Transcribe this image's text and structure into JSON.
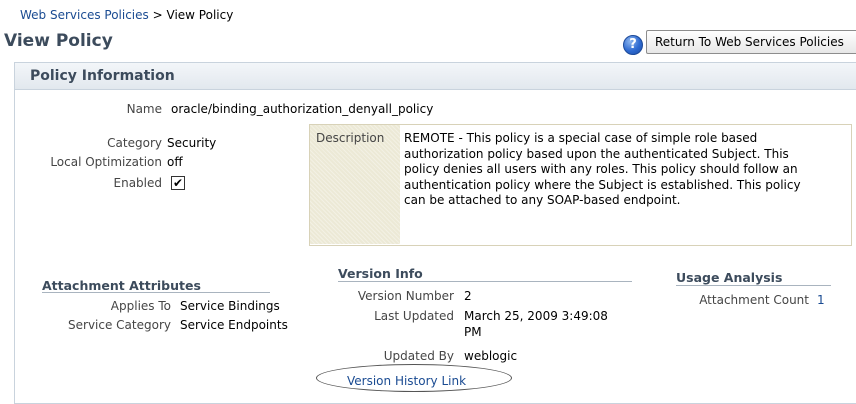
{
  "breadcrumb": {
    "parent": "Web Services Policies",
    "separator": ">",
    "current": "View Policy"
  },
  "page": {
    "title": "View Policy"
  },
  "toolbar": {
    "help_glyph": "?",
    "return_label": "Return To Web Services Policies"
  },
  "panel": {
    "title": "Policy Information"
  },
  "policy": {
    "name_label": "Name",
    "name": "oracle/binding_authorization_denyall_policy",
    "category_label": "Category",
    "category": "Security",
    "local_opt_label": "Local Optimization",
    "local_opt": "off",
    "enabled_label": "Enabled",
    "enabled_mark": "✔",
    "description_label": "Description",
    "description": "REMOTE - This policy is a special case of simple role based authorization policy based upon the authenticated Subject. This policy denies all users with any roles. This policy should follow an authentication policy where the Subject is established. This policy can be attached to any SOAP-based endpoint."
  },
  "attachment": {
    "title": "Attachment Attributes",
    "applies_to_label": "Applies To",
    "applies_to": "Service Bindings",
    "service_category_label": "Service Category",
    "service_category": "Service Endpoints"
  },
  "version": {
    "title": "Version Info",
    "number_label": "Version Number",
    "number": "2",
    "last_updated_label": "Last Updated",
    "last_updated_line1": "March 25, 2009 3:49:08",
    "last_updated_line2": "PM",
    "updated_by_label": "Updated By",
    "updated_by": "weblogic",
    "history_link": "Version History Link"
  },
  "usage": {
    "title": "Usage Analysis",
    "count_label": "Attachment Count",
    "count": "1"
  }
}
